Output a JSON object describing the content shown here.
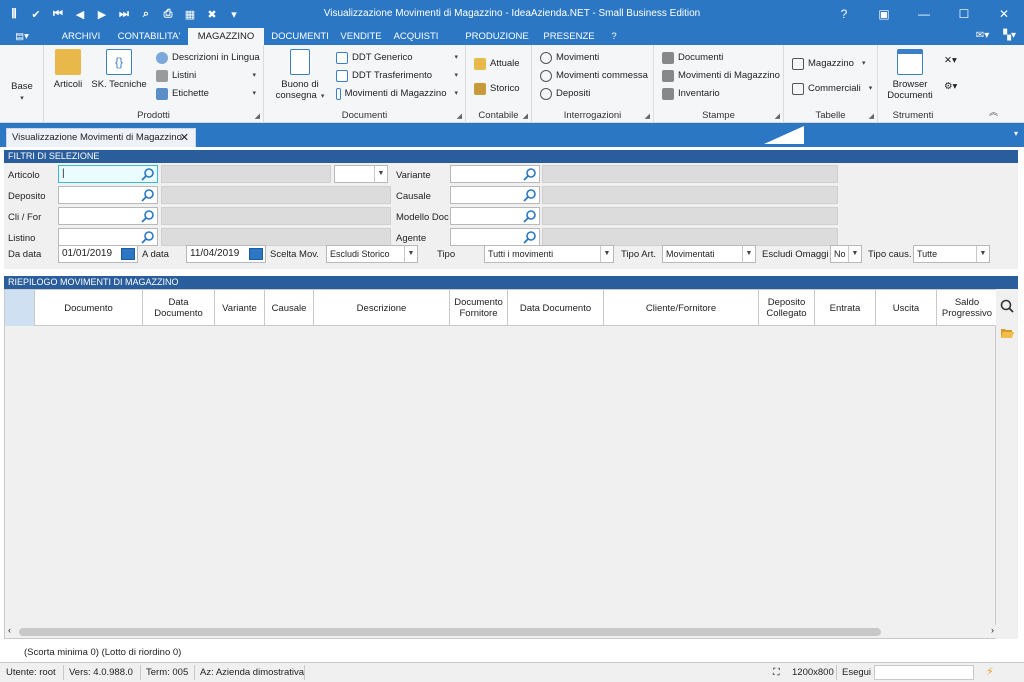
{
  "window": {
    "title": "Visualizzazione Movimenti di Magazzino - IdeaAzienda.NET - Small Business Edition",
    "help": "?"
  },
  "menu": {
    "tabs": [
      "ARCHIVI",
      "CONTABILITA'",
      "MAGAZZINO",
      "DOCUMENTI",
      "VENDITE",
      "ACQUISTI",
      "PRODUZIONE",
      "PRESENZE",
      "?"
    ],
    "active": "MAGAZZINO"
  },
  "ribbon": {
    "base": {
      "label": "Base"
    },
    "prodotti": {
      "label": "Prodotti",
      "articoli": "Articoli",
      "sk_tecniche": "SK. Tecniche",
      "descrizioni": "Descrizioni in Lingua",
      "listini": "Listini",
      "etichette": "Etichette"
    },
    "documenti": {
      "label": "Documenti",
      "buono": "Buono di",
      "buono2": "consegna",
      "ddt_generico": "DDT Generico",
      "ddt_trasferimento": "DDT Trasferimento",
      "movimenti": "Movimenti di Magazzino"
    },
    "contabile": {
      "label": "Contabile",
      "attuale": "Attuale",
      "storico": "Storico"
    },
    "interrogazioni": {
      "label": "Interrogazioni",
      "movimenti": "Movimenti",
      "movimenti_commessa": "Movimenti commessa",
      "depositi": "Depositi"
    },
    "stampe": {
      "label": "Stampe",
      "documenti": "Documenti",
      "movimenti": "Movimenti di Magazzino",
      "inventario": "Inventario"
    },
    "tabelle": {
      "label": "Tabelle",
      "magazzino": "Magazzino",
      "commerciali": "Commerciali"
    },
    "strumenti": {
      "label": "Strumenti",
      "browser": "Browser",
      "browser2": "Documenti"
    }
  },
  "doc_tab": {
    "label": "Visualizzazione Movimenti di Magazzino"
  },
  "filters": {
    "header": "FILTRI DI SELEZIONE",
    "articolo": "Articolo",
    "deposito": "Deposito",
    "cli_for": "Cli / For",
    "listino": "Listino",
    "variante": "Variante",
    "causale": "Causale",
    "modello_doc": "Modello Doc",
    "agente": "Agente",
    "da_data": "Da data",
    "da_data_value": "01/01/2019",
    "a_data": "A data",
    "a_data_value": "11/04/2019",
    "scelta_mov": "Scelta Mov.",
    "scelta_mov_value": "Escludi Storico",
    "tipo": "Tipo",
    "tipo_value": "Tutti i movimenti",
    "tipo_art": "Tipo Art.",
    "tipo_art_value": "Movimentati",
    "escludi_omaggi": "Escludi Omaggi",
    "escludi_omaggi_value": "No",
    "tipo_caus": "Tipo caus.",
    "tipo_caus_value": "Tutte"
  },
  "grid": {
    "header": "RIEPILOGO MOVIMENTI DI MAGAZZINO",
    "columns": [
      "Documento",
      "Data Documento",
      "Variante",
      "Causale",
      "Descrizione",
      "Documento Fornitore",
      "Data Documento",
      "Cliente/Fornitore",
      "Deposito Collegato",
      "Entrata",
      "Uscita",
      "Saldo Progressivo"
    ]
  },
  "footer_note": "(Scorta minima  0)  (Lotto di riordino 0)",
  "status": {
    "utente": "Utente: root",
    "vers": "Vers: 4.0.988.0",
    "term": "Term: 005",
    "az": "Az: Azienda dimostrativa",
    "resolution": "1200x800",
    "esegui": "Esegui"
  },
  "colors": {
    "accent": "#2b77c4",
    "panel_header": "#2a5d9c"
  }
}
